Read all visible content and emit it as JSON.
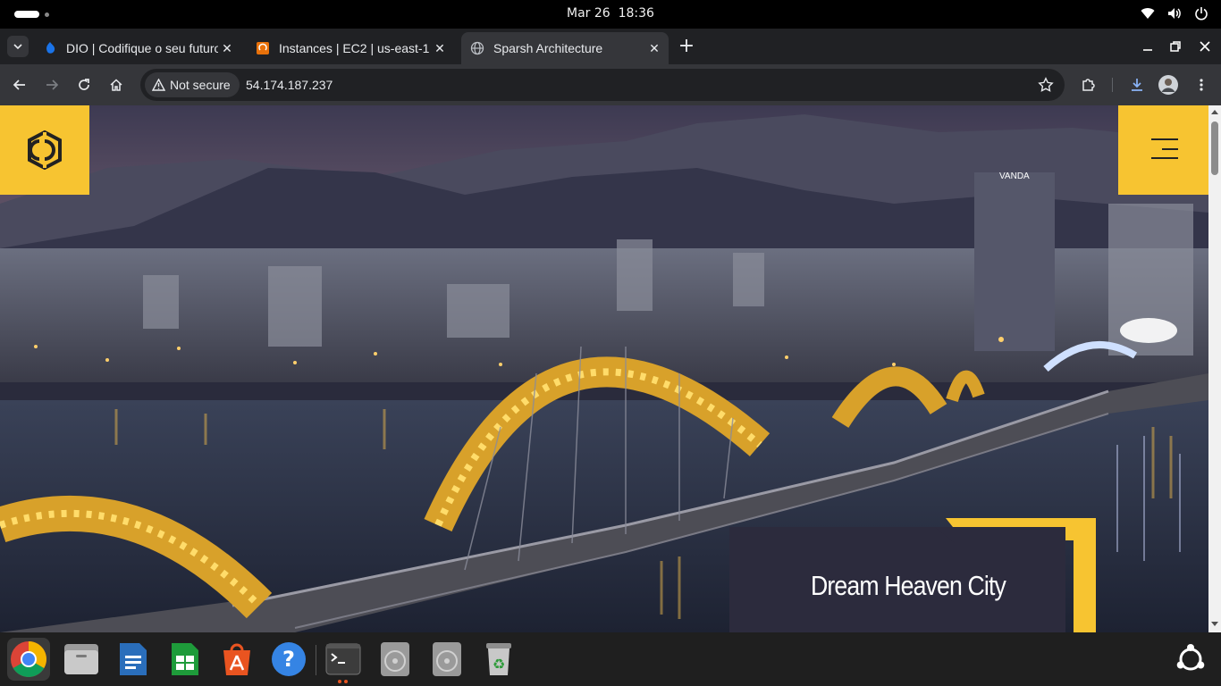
{
  "topbar": {
    "clock_date": "Mar 26",
    "clock_time": "18:36"
  },
  "tabs": [
    {
      "title": "DIO | Codifique o seu futuro",
      "favicon": "dio-icon",
      "active": false
    },
    {
      "title": "Instances | EC2 | us-east-1",
      "favicon": "aws-icon",
      "active": false
    },
    {
      "title": "Sparsh Architecture",
      "favicon": "globe-icon",
      "active": true
    }
  ],
  "toolbar": {
    "security_label": "Not secure",
    "url": "54.174.187.237"
  },
  "page": {
    "caption_title": "Dream Heaven City",
    "accent_color": "#f7c431",
    "caption_bg": "#2c2b3d"
  },
  "dock": {
    "apps": [
      "chrome-icon",
      "files-icon",
      "writer-icon",
      "calc-icon",
      "app-center-icon",
      "help-icon",
      "terminal-icon",
      "disc-icon",
      "disc-icon",
      "trash-icon",
      "show-apps-icon"
    ]
  }
}
